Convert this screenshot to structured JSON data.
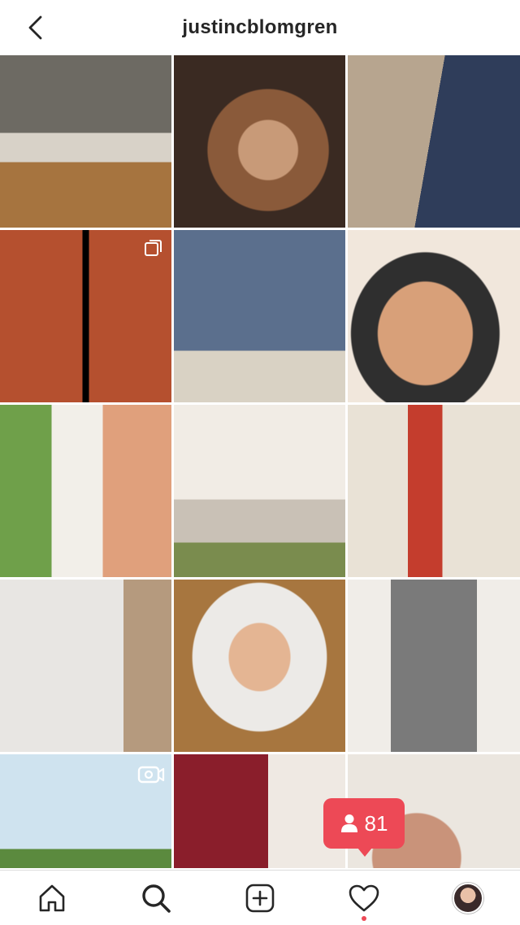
{
  "header": {
    "title": "justincblomgren",
    "back_icon": "chevron-left-icon"
  },
  "grid": {
    "tiles": [
      {
        "name": "post-friends-cafe",
        "colors": [
          "#6d6a63",
          "#2b3a4a",
          "#d8d2c8"
        ],
        "badge": "none"
      },
      {
        "name": "post-shirtless-room",
        "colors": [
          "#8a5a3a",
          "#3a2a22",
          "#c89a78"
        ],
        "badge": "none"
      },
      {
        "name": "post-sweaters-couch",
        "colors": [
          "#b7a58f",
          "#2f3d5a",
          "#e6d9c8"
        ],
        "badge": "none"
      },
      {
        "name": "post-film-strip",
        "colors": [
          "#000000",
          "#b5502f",
          "#e8b07a"
        ],
        "badge": "carousel"
      },
      {
        "name": "post-window-pose",
        "colors": [
          "#5b6f8d",
          "#d9d2c4",
          "#2a3558"
        ],
        "badge": "none"
      },
      {
        "name": "post-selfie-couple",
        "colors": [
          "#d8a079",
          "#2f2f2f",
          "#f1e7dc"
        ],
        "badge": "none"
      },
      {
        "name": "post-shower-plant",
        "colors": [
          "#f2efe9",
          "#6fa04a",
          "#e0a07c"
        ],
        "badge": "none"
      },
      {
        "name": "post-living-room",
        "colors": [
          "#f1ece5",
          "#c9c1b6",
          "#7a8c4e"
        ],
        "badge": "none"
      },
      {
        "name": "post-alpacas",
        "colors": [
          "#c43d2d",
          "#e9e2d6",
          "#4b5d7a"
        ],
        "badge": "none"
      },
      {
        "name": "post-curtain-window",
        "colors": [
          "#e8e6e3",
          "#b59a7e",
          "#5a4a3a"
        ],
        "badge": "none"
      },
      {
        "name": "post-pillow-selfie",
        "colors": [
          "#eceae7",
          "#a7763f",
          "#e4b593"
        ],
        "badge": "none"
      },
      {
        "name": "post-robes-mirror",
        "colors": [
          "#f0ede8",
          "#7a7a7a",
          "#c59d7c"
        ],
        "badge": "none"
      },
      {
        "name": "post-eiffel-tower",
        "colors": [
          "#cfe3ef",
          "#5b8a3e",
          "#1f3a2a"
        ],
        "badge": "video"
      },
      {
        "name": "post-couple-tee",
        "colors": [
          "#8a1e2b",
          "#efe9e3",
          "#1d2a2a"
        ],
        "badge": "none"
      },
      {
        "name": "post-kitchen-shirtless",
        "colors": [
          "#ebe6df",
          "#c9937a",
          "#6b8a4c"
        ],
        "badge": "none"
      }
    ]
  },
  "notification": {
    "icon": "person-icon",
    "count": "81",
    "color": "#ed4956"
  },
  "tabbar": {
    "items": [
      {
        "name": "tab-home",
        "icon": "home-icon"
      },
      {
        "name": "tab-search",
        "icon": "search-icon"
      },
      {
        "name": "tab-new-post",
        "icon": "plus-square-icon"
      },
      {
        "name": "tab-activity",
        "icon": "heart-icon"
      },
      {
        "name": "tab-profile",
        "icon": "avatar"
      }
    ]
  }
}
